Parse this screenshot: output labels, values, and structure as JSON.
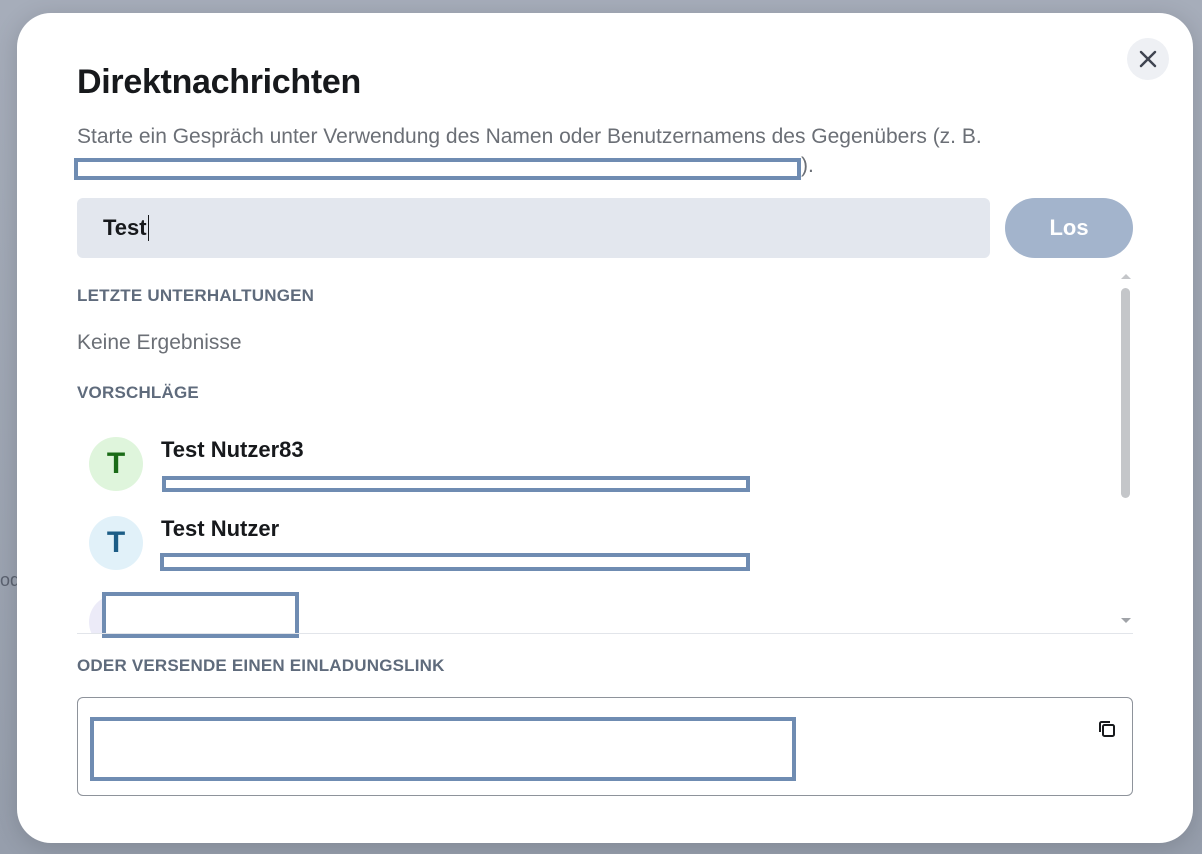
{
  "backdrop": {
    "partial_text": "od"
  },
  "dialog": {
    "title": "Direktnachrichten",
    "description": "Starte ein Gespräch unter Verwendung des Namen oder Benutzernamens des Gegenübers (z. B.",
    "description_end": ").",
    "close_icon": "close-icon"
  },
  "search": {
    "value": "Test",
    "go_label": "Los"
  },
  "recent": {
    "label": "LETZTE UNTERHALTUNGEN",
    "empty_text": "Keine Ergebnisse"
  },
  "suggestions": {
    "label": "VORSCHLÄGE",
    "items": [
      {
        "initial": "T",
        "name": "Test Nutzer83",
        "avatar_bg": "#dff5dc",
        "avatar_fg": "#1a6b17"
      },
      {
        "initial": "T",
        "name": "Test Nutzer",
        "avatar_bg": "#e1f1f9",
        "avatar_fg": "#1c5d86"
      },
      {
        "initial": "",
        "name": "",
        "avatar_bg": "#ecebf8",
        "avatar_fg": "#4a4a8a"
      }
    ]
  },
  "invite": {
    "label": "ODER VERSENDE EINEN EINLADUNGSLINK",
    "copy_icon": "copy-icon"
  },
  "colors": {
    "accent_button": "#a3b4cc",
    "redaction": "#6f8cb2"
  }
}
